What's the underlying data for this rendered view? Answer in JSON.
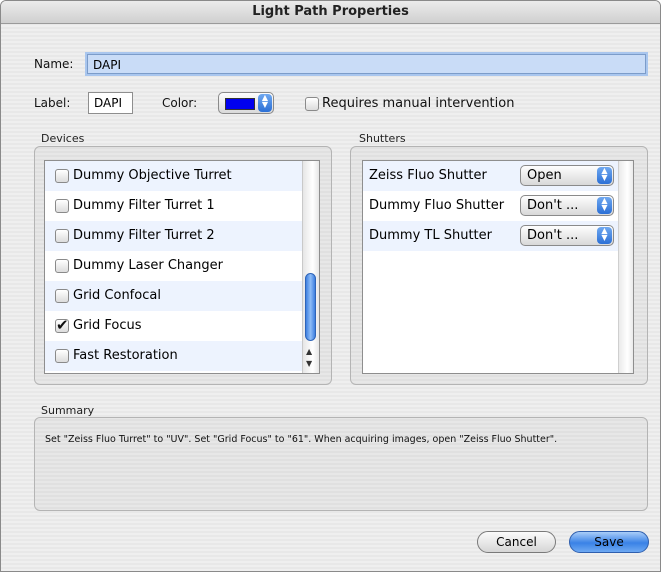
{
  "window": {
    "title": "Light Path Properties"
  },
  "form": {
    "name_label": "Name:",
    "name_value": "DAPI",
    "label_label": "Label:",
    "label_value": "DAPI",
    "color_label": "Color:",
    "color_value": "#0000ee",
    "manual_label": "Requires manual intervention",
    "manual_checked": false
  },
  "devices": {
    "title": "Devices",
    "items": [
      {
        "label": "Dummy Objective Turret",
        "checked": false
      },
      {
        "label": "Dummy Filter Turret 1",
        "checked": false
      },
      {
        "label": "Dummy Filter Turret 2",
        "checked": false
      },
      {
        "label": "Dummy Laser Changer",
        "checked": false
      },
      {
        "label": "Grid Confocal",
        "checked": false
      },
      {
        "label": "Grid Focus",
        "checked": true
      },
      {
        "label": "Fast Restoration",
        "checked": false
      }
    ]
  },
  "shutters": {
    "title": "Shutters",
    "items": [
      {
        "label": "Zeiss Fluo Shutter",
        "value": "Open"
      },
      {
        "label": "Dummy Fluo Shutter",
        "value": "Don't ..."
      },
      {
        "label": "Dummy TL Shutter",
        "value": "Don't ..."
      }
    ]
  },
  "summary": {
    "title": "Summary",
    "text": "Set \"Zeiss Fluo Turret\" to \"UV\".  Set \"Grid Focus\" to \"61\".  When acquiring images, open \"Zeiss Fluo Shutter\"."
  },
  "buttons": {
    "cancel": "Cancel",
    "save": "Save"
  }
}
